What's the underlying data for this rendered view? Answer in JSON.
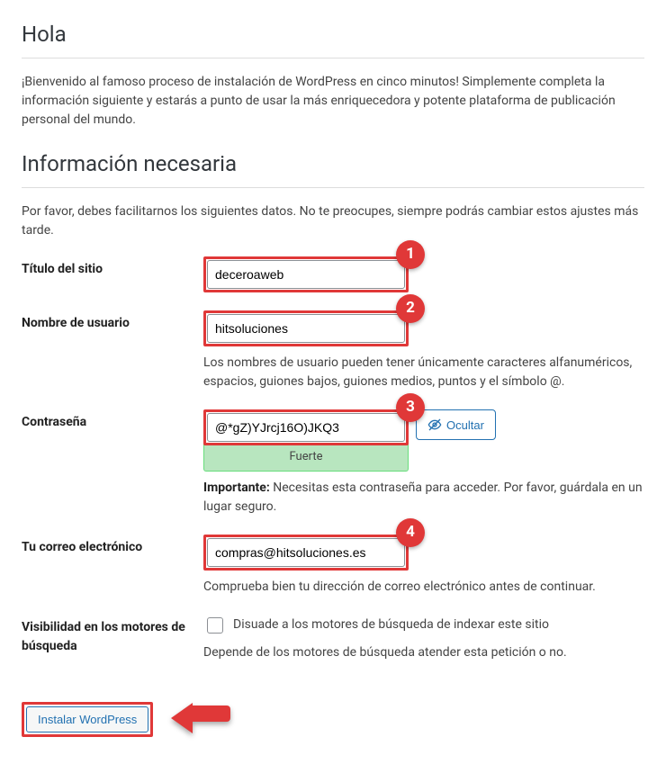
{
  "greeting_heading": "Hola",
  "greeting_paragraph": "¡Bienvenido al famoso proceso de instalación de WordPress en cinco minutos! Simplemente completa la información siguiente y estarás a punto de usar la más enriquecedora y potente plataforma de publicación personal del mundo.",
  "section_heading": "Información necesaria",
  "section_paragraph": "Por favor, debes facilitarnos los siguientes datos. No te preocupes, siempre podrás cambiar estos ajustes más tarde.",
  "fields": {
    "site_title": {
      "label": "Título del sitio",
      "value": "deceroaweb"
    },
    "username": {
      "label": "Nombre de usuario",
      "value": "hitsoluciones",
      "help": "Los nombres de usuario pueden tener únicamente caracteres alfanuméricos, espacios, guiones bajos, guiones medios, puntos y el símbolo @."
    },
    "password": {
      "label": "Contraseña",
      "value": "@*gZ)YJrcj16O)JKQ3",
      "hide_label": "Ocultar",
      "strength": "Fuerte",
      "important_label": "Importante:",
      "important_text": " Necesitas esta contraseña para acceder. Por favor, guárdala en un lugar seguro."
    },
    "email": {
      "label": "Tu correo electrónico",
      "value": "compras@hitsoluciones.es",
      "help": "Comprueba bien tu dirección de correo electrónico antes de continuar."
    },
    "visibility": {
      "label": "Visibilidad en los motores de búsqueda",
      "checkbox_label": "Disuade a los motores de búsqueda de indexar este sitio",
      "help": "Depende de los motores de búsqueda atender esta petición o no."
    }
  },
  "badges": {
    "b1": "1",
    "b2": "2",
    "b3": "3",
    "b4": "4"
  },
  "install_button": "Instalar WordPress"
}
